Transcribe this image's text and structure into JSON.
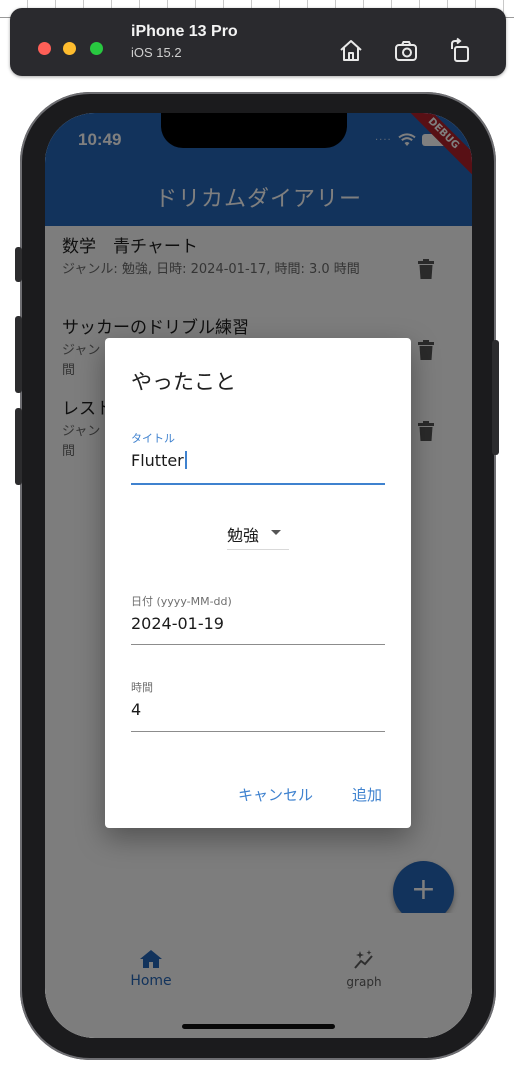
{
  "simulator": {
    "device_name": "iPhone 13 Pro",
    "os_version": "iOS 15.2",
    "toolbar_icons": [
      "home-icon",
      "screenshot-icon",
      "rotate-icon"
    ],
    "background_color": "#2a2a2e"
  },
  "status_bar": {
    "time": "10:49",
    "cell_signal": "····"
  },
  "debug_banner": "DEBUG",
  "app_bar": {
    "title": "ドリカムダイアリー",
    "color": "#2566b8"
  },
  "entries": [
    {
      "title": "数学　青チャート",
      "subtitle": "ジャンル: 勉強, 日時: 2024-01-17, 時間: 3.0 時間"
    },
    {
      "title": "サッカーのドリブル練習",
      "subtitle": "ジャン…\n間"
    },
    {
      "title": "レスト",
      "subtitle": "ジャン…\n間"
    }
  ],
  "visible_entry_fragments": {
    "item2_title": "サッカーのドリブル練習",
    "item2_sub": "ジャン",
    "item2_sub2": "間",
    "item3_title": "レスト",
    "item3_sub": "ジャン",
    "item3_sub2": "間"
  },
  "dialog": {
    "title": "やったこと",
    "title_field": {
      "label": "タイトル",
      "value": "Flutter"
    },
    "genre_dropdown": {
      "value": "勉強"
    },
    "date_field": {
      "label": "日付 (yyyy-MM-dd)",
      "value": "2024-01-19"
    },
    "time_field": {
      "label": "時間",
      "value": "4"
    },
    "cancel_label": "キャンセル",
    "add_label": "追加",
    "accent_color": "#3f82cf"
  },
  "fab": {
    "symbol": "+"
  },
  "bottom_nav": [
    {
      "label": "Home",
      "icon": "home-icon",
      "selected": true
    },
    {
      "label": "graph",
      "icon": "sparkle-graph-icon",
      "selected": false
    }
  ]
}
